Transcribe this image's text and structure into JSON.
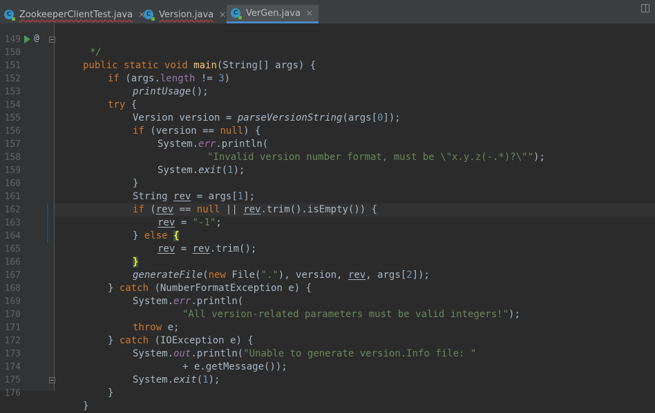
{
  "tabs": [
    {
      "label": "ZookeeperClientTest.java",
      "icon": "class-icon",
      "active": false
    },
    {
      "label": "Version.java",
      "icon": "class-icon",
      "active": false
    },
    {
      "label": "VerGen.java",
      "icon": "class-icon",
      "active": true
    }
  ],
  "tab_close": "×",
  "gutter": {
    "line_numbers": [
      "149",
      "150",
      "151",
      "152",
      "153",
      "154",
      "155",
      "156",
      "157",
      "158",
      "159",
      "160",
      "161",
      "162",
      "163",
      "164",
      "165",
      "166",
      "167",
      "168",
      "169",
      "170",
      "171",
      "172",
      "173",
      "174",
      "175",
      "176"
    ],
    "override_marker": "@"
  },
  "code": {
    "l149": [
      "*/"
    ],
    "l150": [
      "public static void ",
      "main",
      "(String[] args) {"
    ],
    "l151": [
      "if ",
      "(args.",
      "length ",
      "!= ",
      "3",
      ")"
    ],
    "l152": [
      "printUsage",
      "();"
    ],
    "l153": [
      "try ",
      "{"
    ],
    "l154": [
      "Version version = ",
      "parseVersionString",
      "(args[",
      "0",
      "]);"
    ],
    "l155": [
      "if ",
      "(version == ",
      "null",
      ") {"
    ],
    "l156": [
      "System.",
      "err",
      ".println("
    ],
    "l157": [
      "\"Invalid version number format, must be \\\"x.y.z(-.*)?\\\"\"",
      ");"
    ],
    "l158": [
      "System.",
      "exit",
      "(",
      "1",
      ");"
    ],
    "l159": [
      "}"
    ],
    "l160": [
      "String ",
      "rev",
      " = args[",
      "1",
      "];"
    ],
    "l161": [
      "if ",
      "(",
      "rev",
      " == ",
      "null ",
      "|| ",
      "rev",
      ".trim().isEmpty()) {"
    ],
    "l162": [
      "rev",
      " = ",
      "\"-1\"",
      ";"
    ],
    "l163": [
      "} ",
      "else ",
      "{"
    ],
    "l164": [
      "rev",
      " = ",
      "rev",
      ".trim();"
    ],
    "l165": [
      "}"
    ],
    "l166": [
      "generateFile",
      "(",
      "new ",
      "File(",
      "\".\"",
      "), version, ",
      "rev",
      ", args[",
      "2",
      "]);"
    ],
    "l167": [
      "} ",
      "catch ",
      "(NumberFormatException e) {"
    ],
    "l168": [
      "System.",
      "err",
      ".println("
    ],
    "l169": [
      "\"All version-related parameters must be valid integers!\"",
      ");"
    ],
    "l170": [
      "throw ",
      "e;"
    ],
    "l171": [
      "} ",
      "catch ",
      "(IOException e) {"
    ],
    "l172": [
      "System.",
      "out",
      ".println(",
      "\"Unable to generate version.Info file: \""
    ],
    "l173": [
      "+ e.getMessage());"
    ],
    "l174": [
      "System.",
      "exit",
      "(",
      "1",
      ");"
    ],
    "l175": [
      "}"
    ],
    "l176": [
      "}"
    ]
  },
  "colors": {
    "background": "#2b2b2b",
    "keyword": "#cc7832",
    "method_decl": "#ffc66d",
    "string": "#6a8759",
    "number": "#6897bb",
    "static_field": "#9876aa",
    "default_text": "#a9b7c6",
    "line_number": "#606366",
    "active_tab_underline": "#4a88c7"
  }
}
